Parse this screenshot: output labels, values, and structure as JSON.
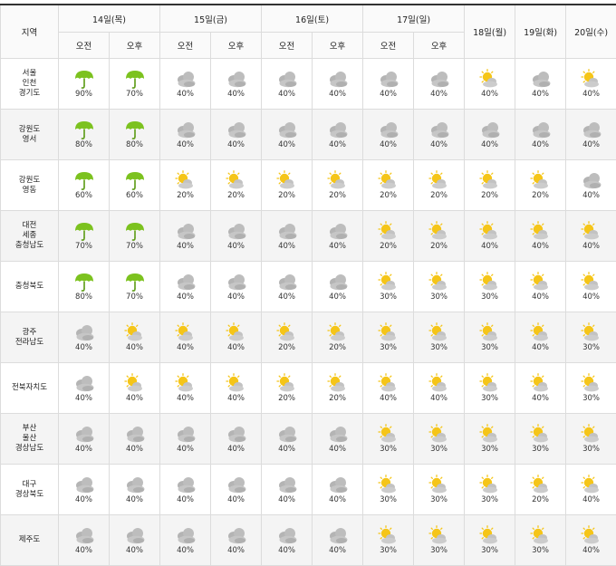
{
  "header": {
    "region_label": "지역",
    "days": [
      {
        "label": "14일(목)",
        "split": true
      },
      {
        "label": "15일(금)",
        "split": true
      },
      {
        "label": "16일(토)",
        "split": true
      },
      {
        "label": "17일(일)",
        "split": true
      },
      {
        "label": "18일(월)",
        "split": false
      },
      {
        "label": "19일(화)",
        "split": false
      },
      {
        "label": "20일(수)",
        "split": false
      }
    ],
    "am_label": "오전",
    "pm_label": "오후"
  },
  "rows": [
    {
      "region": [
        "서울",
        "인천",
        "경기도"
      ],
      "cells": [
        {
          "icon": "umbrella-icon",
          "pct": "90%"
        },
        {
          "icon": "umbrella-icon",
          "pct": "70%"
        },
        {
          "icon": "cloudy-icon",
          "pct": "40%"
        },
        {
          "icon": "cloudy-icon",
          "pct": "40%"
        },
        {
          "icon": "cloudy-icon",
          "pct": "40%"
        },
        {
          "icon": "cloudy-icon",
          "pct": "40%"
        },
        {
          "icon": "cloudy-icon",
          "pct": "40%"
        },
        {
          "icon": "cloudy-icon",
          "pct": "40%"
        },
        {
          "icon": "partly-cloudy-icon",
          "pct": "40%"
        },
        {
          "icon": "cloudy-icon",
          "pct": "40%"
        },
        {
          "icon": "partly-cloudy-icon",
          "pct": "40%"
        }
      ]
    },
    {
      "region": [
        "강원도",
        "영서"
      ],
      "cells": [
        {
          "icon": "umbrella-icon",
          "pct": "80%"
        },
        {
          "icon": "umbrella-icon",
          "pct": "80%"
        },
        {
          "icon": "cloudy-icon",
          "pct": "40%"
        },
        {
          "icon": "cloudy-icon",
          "pct": "40%"
        },
        {
          "icon": "cloudy-icon",
          "pct": "40%"
        },
        {
          "icon": "cloudy-icon",
          "pct": "40%"
        },
        {
          "icon": "cloudy-icon",
          "pct": "40%"
        },
        {
          "icon": "cloudy-icon",
          "pct": "40%"
        },
        {
          "icon": "cloudy-icon",
          "pct": "40%"
        },
        {
          "icon": "cloudy-icon",
          "pct": "40%"
        },
        {
          "icon": "cloudy-icon",
          "pct": "40%"
        }
      ]
    },
    {
      "region": [
        "강원도",
        "영동"
      ],
      "cells": [
        {
          "icon": "umbrella-icon",
          "pct": "60%"
        },
        {
          "icon": "umbrella-icon",
          "pct": "60%"
        },
        {
          "icon": "partly-cloudy-icon",
          "pct": "20%"
        },
        {
          "icon": "partly-cloudy-icon",
          "pct": "20%"
        },
        {
          "icon": "partly-cloudy-icon",
          "pct": "20%"
        },
        {
          "icon": "partly-cloudy-icon",
          "pct": "20%"
        },
        {
          "icon": "partly-cloudy-icon",
          "pct": "20%"
        },
        {
          "icon": "partly-cloudy-icon",
          "pct": "20%"
        },
        {
          "icon": "partly-cloudy-icon",
          "pct": "20%"
        },
        {
          "icon": "partly-cloudy-icon",
          "pct": "20%"
        },
        {
          "icon": "cloudy-icon",
          "pct": "40%"
        }
      ]
    },
    {
      "region": [
        "대전",
        "세종",
        "충청남도"
      ],
      "cells": [
        {
          "icon": "umbrella-icon",
          "pct": "70%"
        },
        {
          "icon": "umbrella-icon",
          "pct": "70%"
        },
        {
          "icon": "cloudy-icon",
          "pct": "40%"
        },
        {
          "icon": "cloudy-icon",
          "pct": "40%"
        },
        {
          "icon": "cloudy-icon",
          "pct": "40%"
        },
        {
          "icon": "cloudy-icon",
          "pct": "40%"
        },
        {
          "icon": "partly-cloudy-icon",
          "pct": "20%"
        },
        {
          "icon": "partly-cloudy-icon",
          "pct": "20%"
        },
        {
          "icon": "partly-cloudy-icon",
          "pct": "40%"
        },
        {
          "icon": "partly-cloudy-icon",
          "pct": "40%"
        },
        {
          "icon": "partly-cloudy-icon",
          "pct": "40%"
        }
      ]
    },
    {
      "region": [
        "충청북도"
      ],
      "cells": [
        {
          "icon": "umbrella-icon",
          "pct": "80%"
        },
        {
          "icon": "umbrella-icon",
          "pct": "70%"
        },
        {
          "icon": "cloudy-icon",
          "pct": "40%"
        },
        {
          "icon": "cloudy-icon",
          "pct": "40%"
        },
        {
          "icon": "cloudy-icon",
          "pct": "40%"
        },
        {
          "icon": "cloudy-icon",
          "pct": "40%"
        },
        {
          "icon": "partly-cloudy-icon",
          "pct": "30%"
        },
        {
          "icon": "partly-cloudy-icon",
          "pct": "30%"
        },
        {
          "icon": "partly-cloudy-icon",
          "pct": "30%"
        },
        {
          "icon": "partly-cloudy-icon",
          "pct": "40%"
        },
        {
          "icon": "partly-cloudy-icon",
          "pct": "40%"
        }
      ]
    },
    {
      "region": [
        "광주",
        "전라남도"
      ],
      "cells": [
        {
          "icon": "cloudy-icon",
          "pct": "40%"
        },
        {
          "icon": "partly-cloudy-icon",
          "pct": "40%"
        },
        {
          "icon": "partly-cloudy-icon",
          "pct": "40%"
        },
        {
          "icon": "partly-cloudy-icon",
          "pct": "40%"
        },
        {
          "icon": "partly-cloudy-icon",
          "pct": "20%"
        },
        {
          "icon": "partly-cloudy-icon",
          "pct": "20%"
        },
        {
          "icon": "partly-cloudy-icon",
          "pct": "30%"
        },
        {
          "icon": "partly-cloudy-icon",
          "pct": "30%"
        },
        {
          "icon": "partly-cloudy-icon",
          "pct": "30%"
        },
        {
          "icon": "partly-cloudy-icon",
          "pct": "40%"
        },
        {
          "icon": "partly-cloudy-icon",
          "pct": "30%"
        }
      ]
    },
    {
      "region": [
        "전북자치도"
      ],
      "cells": [
        {
          "icon": "cloudy-icon",
          "pct": "40%"
        },
        {
          "icon": "partly-cloudy-icon",
          "pct": "40%"
        },
        {
          "icon": "partly-cloudy-icon",
          "pct": "40%"
        },
        {
          "icon": "partly-cloudy-icon",
          "pct": "40%"
        },
        {
          "icon": "partly-cloudy-icon",
          "pct": "20%"
        },
        {
          "icon": "partly-cloudy-icon",
          "pct": "20%"
        },
        {
          "icon": "partly-cloudy-icon",
          "pct": "40%"
        },
        {
          "icon": "partly-cloudy-icon",
          "pct": "40%"
        },
        {
          "icon": "partly-cloudy-icon",
          "pct": "30%"
        },
        {
          "icon": "partly-cloudy-icon",
          "pct": "40%"
        },
        {
          "icon": "partly-cloudy-icon",
          "pct": "30%"
        }
      ]
    },
    {
      "region": [
        "부산",
        "울산",
        "경상남도"
      ],
      "cells": [
        {
          "icon": "cloudy-icon",
          "pct": "40%"
        },
        {
          "icon": "cloudy-icon",
          "pct": "40%"
        },
        {
          "icon": "cloudy-icon",
          "pct": "40%"
        },
        {
          "icon": "cloudy-icon",
          "pct": "40%"
        },
        {
          "icon": "cloudy-icon",
          "pct": "40%"
        },
        {
          "icon": "cloudy-icon",
          "pct": "40%"
        },
        {
          "icon": "partly-cloudy-icon",
          "pct": "30%"
        },
        {
          "icon": "partly-cloudy-icon",
          "pct": "30%"
        },
        {
          "icon": "partly-cloudy-icon",
          "pct": "30%"
        },
        {
          "icon": "partly-cloudy-icon",
          "pct": "30%"
        },
        {
          "icon": "partly-cloudy-icon",
          "pct": "30%"
        }
      ]
    },
    {
      "region": [
        "대구",
        "경상북도"
      ],
      "cells": [
        {
          "icon": "cloudy-icon",
          "pct": "40%"
        },
        {
          "icon": "cloudy-icon",
          "pct": "40%"
        },
        {
          "icon": "cloudy-icon",
          "pct": "40%"
        },
        {
          "icon": "cloudy-icon",
          "pct": "40%"
        },
        {
          "icon": "cloudy-icon",
          "pct": "40%"
        },
        {
          "icon": "cloudy-icon",
          "pct": "40%"
        },
        {
          "icon": "partly-cloudy-icon",
          "pct": "30%"
        },
        {
          "icon": "partly-cloudy-icon",
          "pct": "30%"
        },
        {
          "icon": "partly-cloudy-icon",
          "pct": "30%"
        },
        {
          "icon": "partly-cloudy-icon",
          "pct": "20%"
        },
        {
          "icon": "partly-cloudy-icon",
          "pct": "40%"
        }
      ]
    },
    {
      "region": [
        "제주도"
      ],
      "cells": [
        {
          "icon": "cloudy-icon",
          "pct": "40%"
        },
        {
          "icon": "cloudy-icon",
          "pct": "40%"
        },
        {
          "icon": "cloudy-icon",
          "pct": "40%"
        },
        {
          "icon": "cloudy-icon",
          "pct": "40%"
        },
        {
          "icon": "cloudy-icon",
          "pct": "40%"
        },
        {
          "icon": "cloudy-icon",
          "pct": "40%"
        },
        {
          "icon": "partly-cloudy-icon",
          "pct": "30%"
        },
        {
          "icon": "partly-cloudy-icon",
          "pct": "30%"
        },
        {
          "icon": "partly-cloudy-icon",
          "pct": "30%"
        },
        {
          "icon": "partly-cloudy-icon",
          "pct": "30%"
        },
        {
          "icon": "partly-cloudy-icon",
          "pct": "40%"
        }
      ]
    }
  ],
  "colors": {
    "umbrella": "#7cc21f",
    "cloud": "#a8a8a8",
    "sun": "#f5c518"
  }
}
